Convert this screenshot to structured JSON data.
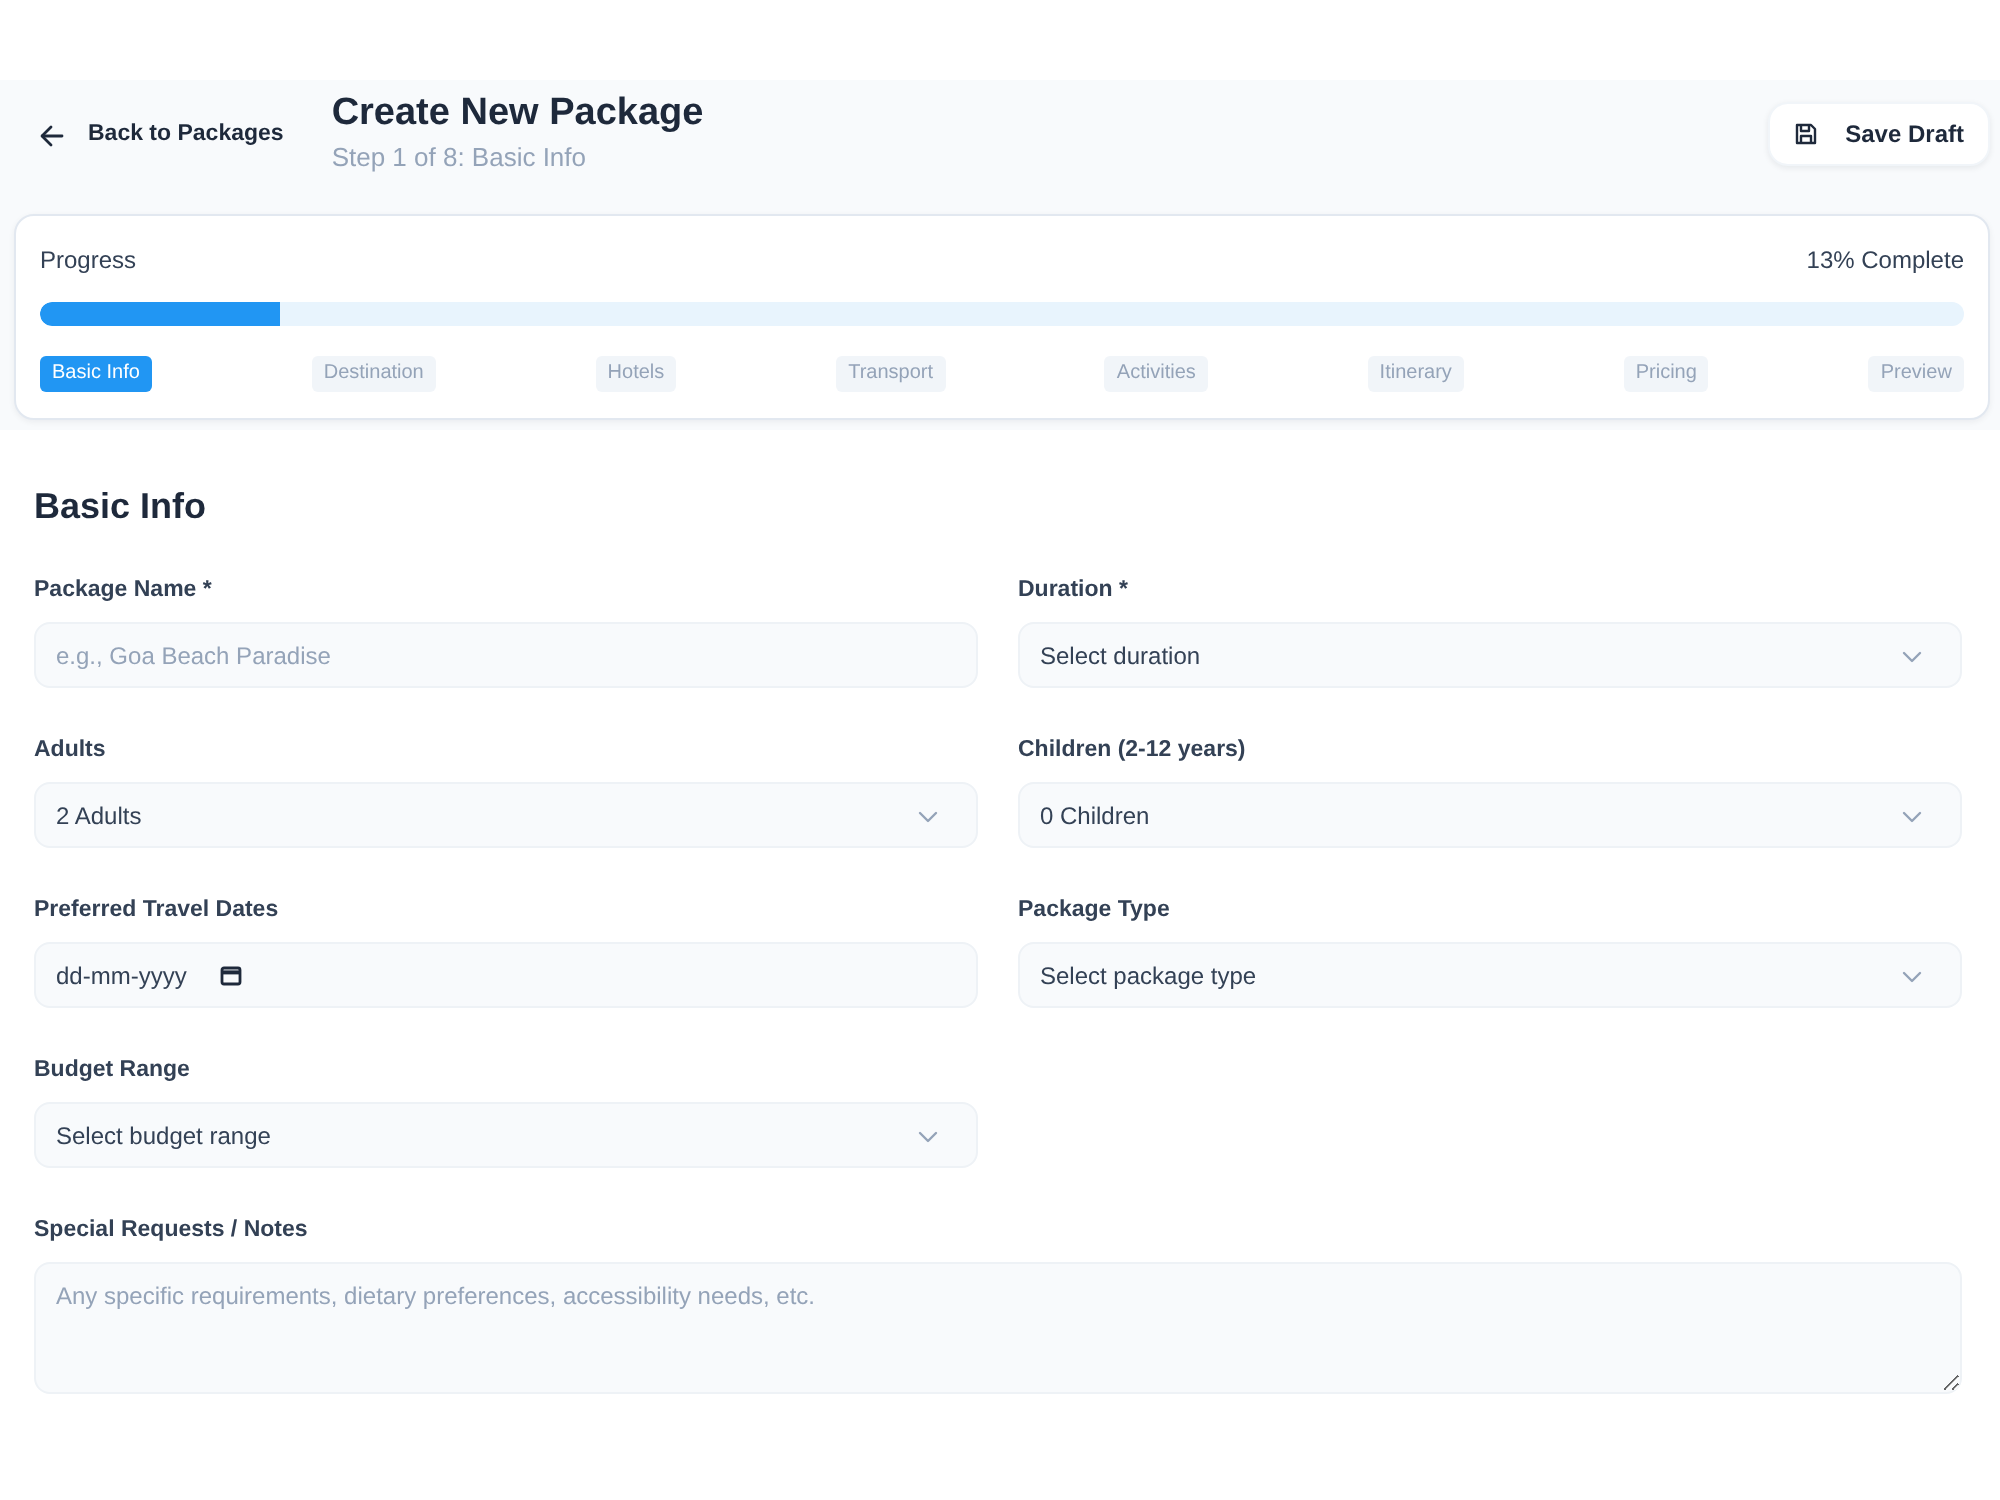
{
  "header": {
    "back_link": "Back to Packages",
    "title": "Create New Package",
    "subtitle": "Step 1 of 8: Basic Info",
    "save_button": "Save Draft"
  },
  "progress": {
    "label": "Progress",
    "reading": "13% Complete",
    "level": 0.125,
    "steps": [
      {
        "label": "Basic Info",
        "selected": true
      },
      {
        "label": "Destination",
        "selected": false
      },
      {
        "label": "Hotels",
        "selected": false
      },
      {
        "label": "Transport",
        "selected": false
      },
      {
        "label": "Activities",
        "selected": false
      },
      {
        "label": "Itinerary",
        "selected": false
      },
      {
        "label": "Pricing",
        "selected": false
      },
      {
        "label": "Preview",
        "selected": false
      }
    ]
  },
  "form": {
    "title": "Basic Info",
    "fields": [
      {
        "kind": "text",
        "label": "Package Name *",
        "placeholder": "e.g., Goa Beach Paradise"
      },
      {
        "kind": "select",
        "label": "Duration *",
        "value": "Select duration"
      },
      {
        "kind": "select",
        "label": "Adults",
        "value": "2 Adults"
      },
      {
        "kind": "select",
        "label": "Children (2-12 years)",
        "value": "0 Children"
      },
      {
        "kind": "date",
        "label": "Preferred Travel Dates",
        "value": "dd-mm-yyyy"
      },
      {
        "kind": "select",
        "label": "Package Type",
        "value": "Select package type"
      },
      {
        "kind": "select",
        "label": "Budget Range",
        "value": "Select budget range"
      },
      {
        "kind": "textarea",
        "label": "Special Requests / Notes",
        "placeholder": "Any specific requirements, dietary preferences, accessibility needs, etc."
      }
    ]
  }
}
